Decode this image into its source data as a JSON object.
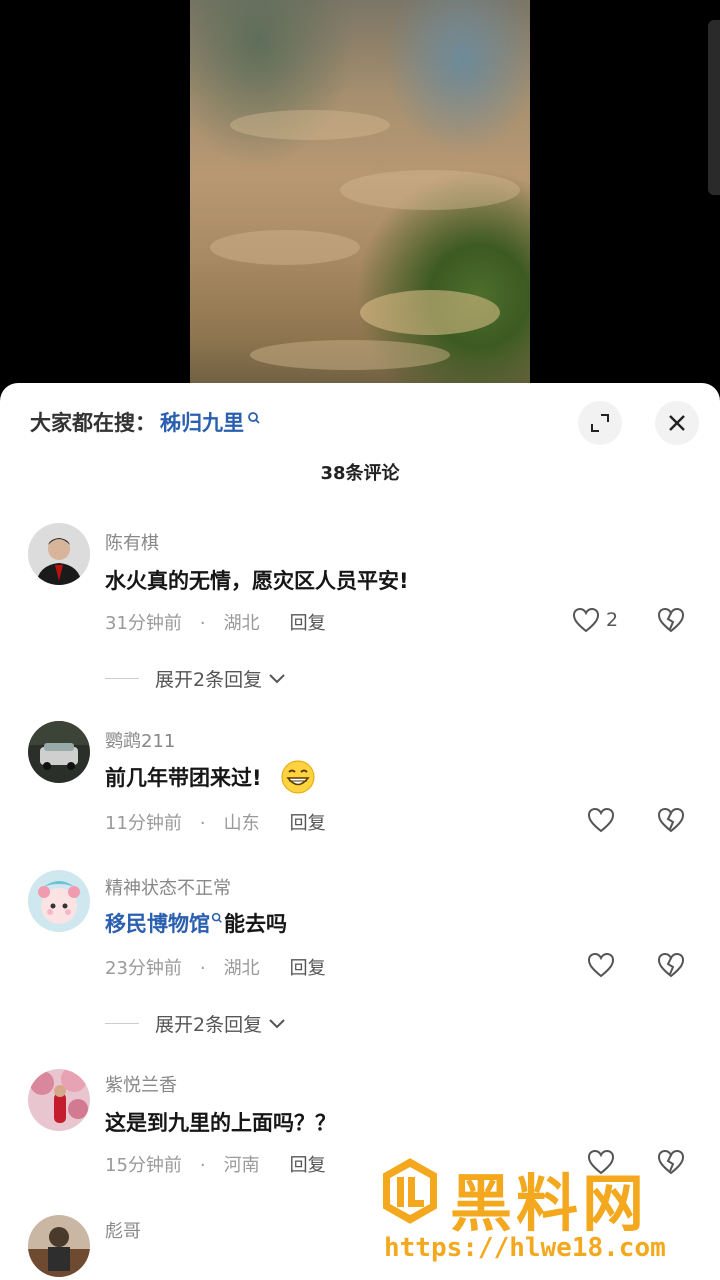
{
  "video": {
    "description_icon": "flood-video-frame"
  },
  "panel": {
    "search_prefix": "大家都在搜：",
    "search_term": "秭归九里",
    "comment_count": "38条评论",
    "icons": {
      "expand": "expand-icon",
      "close": "close-icon"
    }
  },
  "comments": [
    {
      "username": "陈有棋",
      "text": "水火真的无情，愿灾区人员平安!",
      "time": "31分钟前",
      "location": "湖北",
      "reply_label": "回复",
      "likes": "2",
      "expand_label": "展开2条回复"
    },
    {
      "username": "鹦鹉211",
      "text": "前几年带团来过!",
      "time": "11分钟前",
      "location": "山东",
      "reply_label": "回复"
    },
    {
      "username": "精神状态不正常",
      "link_text": "移民博物馆",
      "text": "能去吗",
      "time": "23分钟前",
      "location": "湖北",
      "reply_label": "回复",
      "expand_label": "展开2条回复"
    },
    {
      "username": "紫悦兰香",
      "text": "这是到九里的上面吗？？",
      "time": "15分钟前",
      "location": "河南",
      "reply_label": "回复"
    },
    {
      "username": "彪哥"
    }
  ],
  "watermark": {
    "brand": "黑料网",
    "url": "https://hlwe18.com"
  },
  "colors": {
    "link": "#2b5fb0",
    "watermark": "#f3a81d"
  }
}
